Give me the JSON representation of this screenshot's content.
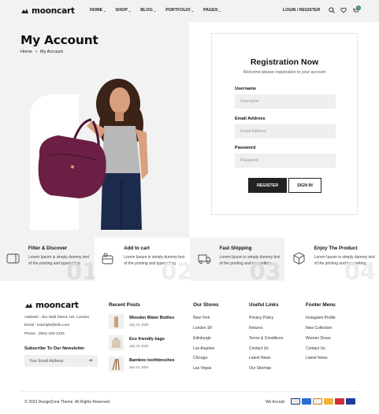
{
  "header": {
    "logo_text": "mooncart",
    "nav": [
      {
        "label": "HOME"
      },
      {
        "label": "SHOP"
      },
      {
        "label": "BLOG"
      },
      {
        "label": "PORTFOLIO"
      },
      {
        "label": "PAGES"
      }
    ],
    "login_label": "LOGIN / REGISTER",
    "cart_count": "0"
  },
  "hero": {
    "title": "My Account",
    "breadcrumb": [
      "Home",
      "My Account"
    ]
  },
  "registration": {
    "title": "Registration Now",
    "subtitle": "Welcome please registration to your account",
    "username_label": "Username",
    "username_placeholder": "Username",
    "email_label": "Email Address",
    "email_placeholder": "Email Address",
    "password_label": "Password",
    "password_placeholder": "Password",
    "register_label": "REGISTER",
    "signin_label": "SIGN IN"
  },
  "features": [
    {
      "title": "Filter & Discover",
      "text": "Lorem Ipsum is simply dummy text of the printing and typesetting",
      "num": "01",
      "icon": "card-icon"
    },
    {
      "title": "Add to cart",
      "text": "Lorem Ipsum is simply dummy text of the printing and typesetting",
      "num": "02",
      "icon": "basket-icon"
    },
    {
      "title": "Fast Shipping",
      "text": "Lorem Ipsum is simply dummy text of the printing and typesetting",
      "num": "03",
      "icon": "truck-icon"
    },
    {
      "title": "Enjoy The Product",
      "text": "Lorem Ipsum is simply dummy text of the printing and typesetting",
      "num": "04",
      "icon": "box-icon"
    }
  ],
  "footer": {
    "logo_text": "mooncart",
    "address": "Address : 451 Wall Street, UK, London",
    "email": "Email : example@info.com",
    "phone": "Phone : (064) 332-1233",
    "newsletter_title": "Subscribe To Our Newsletter",
    "newsletter_placeholder": "Your Email Address",
    "recent_posts_title": "Recent Posts",
    "posts": [
      {
        "title": "Wooden Water Bottles",
        "date": "July 23, 2023"
      },
      {
        "title": "Eco friendly bags",
        "date": "July 23, 2023"
      },
      {
        "title": "Bamboo toothbrushes",
        "date": "July 23, 2023"
      }
    ],
    "stores_title": "Our Stores",
    "stores": [
      "New York",
      "London SF",
      "Edinburgh",
      "Los Angeles",
      "Chicago",
      "Las Vegas"
    ],
    "useful_title": "Useful Links",
    "useful": [
      "Privacy Policy",
      "Returns",
      "Terms & Conditions",
      "Contact Us",
      "Latest News",
      "Our Sitemap"
    ],
    "menu_title": "Footer Menu",
    "menu": [
      "Instagram Profile",
      "New Collection",
      "Women Dress",
      "Contact Us",
      "Latest News"
    ],
    "copyright": "© 2023 DexignZone Theme. All Rights Reserved.",
    "we_accept": "We Accept:",
    "payment_icons": [
      "visa-icon",
      "amex-icon",
      "discover-icon",
      "mastercard-icon",
      "paypal-icon",
      "visa-blue-icon"
    ]
  },
  "colors": {
    "accent": "#2f8a5c",
    "bg_light": "#f2f2f2",
    "dark": "#222222",
    "bag": "#6b1f45"
  }
}
